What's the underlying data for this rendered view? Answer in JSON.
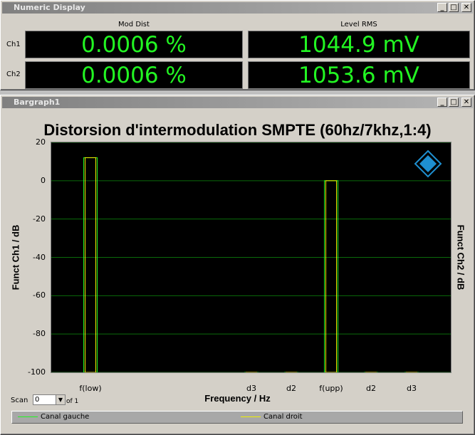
{
  "numeric_display": {
    "title": "Numeric Display",
    "col_headers": [
      "Mod Dist",
      "Level RMS"
    ],
    "rows": [
      {
        "label": "Ch1",
        "mod_dist": "0.0006 %",
        "level_rms": "1044.9 mV"
      },
      {
        "label": "Ch2",
        "mod_dist": "0.0006 %",
        "level_rms": "1053.6 mV"
      }
    ],
    "value_color": "#22f522"
  },
  "bargraph": {
    "title": "Bargraph1",
    "scan_label": "Scan",
    "scan_value": "0",
    "scan_of": "of 1",
    "legend": [
      {
        "label": "Canal gauche",
        "color": "#22f522"
      },
      {
        "label": "Canal droit",
        "color": "#f0f000"
      }
    ],
    "logo_icon": "rohde-schwarz-logo-icon"
  },
  "window_buttons": {
    "minimize": "_",
    "maximize": "□",
    "close": "✕"
  },
  "chart_data": {
    "type": "bar",
    "title": "Distorsion d'intermodulation SMPTE (60hz/7khz,1:4)",
    "xlabel": "Frequency / Hz",
    "ylabel_left": "Funct Ch1 / dB",
    "ylabel_right": "Funct Ch2 / dB",
    "ylim": [
      -100,
      20
    ],
    "yticks": [
      20,
      0,
      -20,
      -40,
      -60,
      -80,
      -100
    ],
    "categories": [
      "f(low)",
      "d3",
      "d2",
      "f(upp)",
      "d2",
      "d3"
    ],
    "series": [
      {
        "name": "Canal gauche",
        "values": [
          12,
          -100,
          -100,
          0,
          -100,
          -100
        ]
      },
      {
        "name": "Canal droit",
        "values": [
          12,
          -100,
          -100,
          0,
          -100,
          -100
        ]
      }
    ],
    "grid": true,
    "grid_color": "#0a6b0a",
    "legend_position": "bottom"
  }
}
